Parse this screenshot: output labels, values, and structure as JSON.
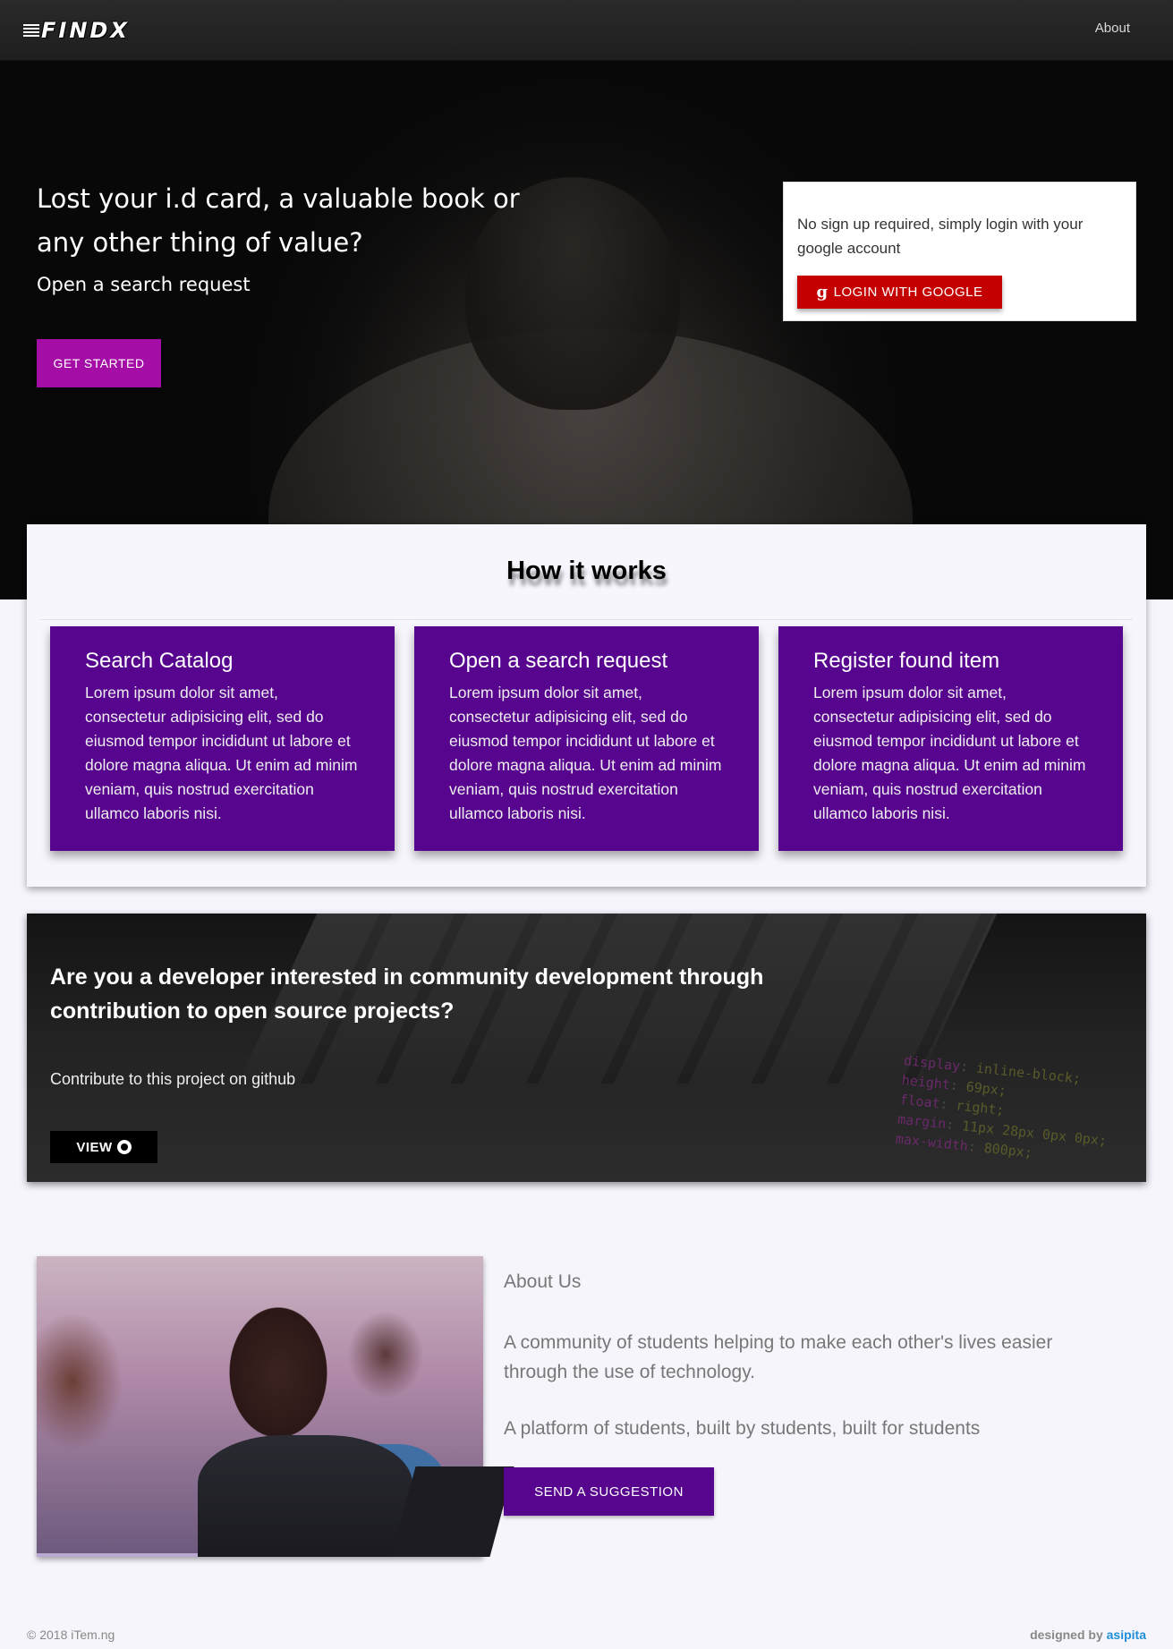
{
  "navbar": {
    "logo_text": "FINDX",
    "about_link": "About"
  },
  "hero": {
    "title": "Lost your i.d card, a valuable book or any other thing of value?",
    "subtitle": "Open a search request",
    "cta_label": "GET STARTED",
    "login_card": {
      "text": "No sign up required, simply login with your google account",
      "button_label": "LOGIN WITH GOOGLE",
      "icon": "google-icon"
    }
  },
  "how_it_works": {
    "title": "How it works",
    "steps": [
      {
        "title": "Search Catalog",
        "body": "Lorem ipsum dolor sit amet, consectetur adipisicing elit, sed do eiusmod tempor incididunt ut labore et dolore magna aliqua. Ut enim ad minim veniam, quis nostrud exercitation ullamco laboris nisi."
      },
      {
        "title": "Open a search request",
        "body": "Lorem ipsum dolor sit amet, consectetur adipisicing elit, sed do eiusmod tempor incididunt ut labore et dolore magna aliqua. Ut enim ad minim veniam, quis nostrud exercitation ullamco laboris nisi."
      },
      {
        "title": "Register found item",
        "body": "Lorem ipsum dolor sit amet, consectetur adipisicing elit, sed do eiusmod tempor incididunt ut labore et dolore magna aliqua. Ut enim ad minim veniam, quis nostrud exercitation ullamco laboris nisi."
      }
    ]
  },
  "developer": {
    "title": "Are you a developer interested in community development through contribution to open source projects?",
    "subtitle": "Contribute to this project on github",
    "button_label": "VIEW",
    "icon": "github-icon",
    "code_lines": [
      {
        "k": "display",
        "v": "inline-block;"
      },
      {
        "k": "height",
        "v": "69px;"
      },
      {
        "k": "float",
        "v": "right;"
      },
      {
        "k": "margin",
        "v": "11px 28px 0px 0px;"
      },
      {
        "k": "max-width",
        "v": "800px;"
      }
    ]
  },
  "about": {
    "heading": "About Us",
    "paragraph1": "A community of students helping to make each other's lives easier through the use of technology.",
    "paragraph2": "A platform of students, built by students, built for students",
    "button_label": "SEND A SUGGESTION"
  },
  "footer": {
    "copyright": "© 2018 iTem.ng",
    "designed_by": "designed by",
    "designer": "asipita"
  },
  "colors": {
    "primary_purple": "#57048f",
    "magenta": "#a40ea6",
    "google_red": "#c40000",
    "link_blue": "#1e8fd8"
  }
}
